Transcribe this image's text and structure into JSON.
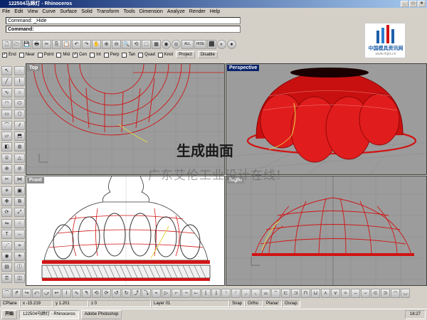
{
  "window": {
    "title": "122504马蹄灯 - Rhinoceros"
  },
  "menu": [
    "File",
    "Edit",
    "View",
    "Curve",
    "Surface",
    "Solid",
    "Transform",
    "Tools",
    "Dimension",
    "Analyze",
    "Render",
    "Help"
  ],
  "command": {
    "history_label": "Command:",
    "history_value": "_Hide",
    "prompt_label": "Command:"
  },
  "toolbar": [
    "🗋",
    "🗁",
    "💾",
    "🖶",
    "✂",
    "⎘",
    "📋",
    "↶",
    "↷",
    "✋",
    "⊕",
    "⊖",
    "🔍",
    "⟲",
    "⬚",
    "▦",
    "◉",
    "◎",
    "ALL",
    "HIDE",
    "⬛",
    "◐",
    "●"
  ],
  "osnap": {
    "items": [
      {
        "label": "End",
        "checked": true
      },
      {
        "label": "Near",
        "checked": false
      },
      {
        "label": "Point",
        "checked": false
      },
      {
        "label": "Mid",
        "checked": false
      },
      {
        "label": "Cen",
        "checked": true
      },
      {
        "label": "Int",
        "checked": false
      },
      {
        "label": "Perp",
        "checked": false
      },
      {
        "label": "Tan",
        "checked": false
      },
      {
        "label": "Quad",
        "checked": false
      },
      {
        "label": "Knot",
        "checked": false
      }
    ],
    "project_label": "Project",
    "disable_label": "Disable"
  },
  "viewports": {
    "top": "Top",
    "perspective": "Perspective",
    "front": "Front",
    "right": "Right"
  },
  "overlay": {
    "line1": "生成曲面",
    "line2": "广东艾伦工业设计在线!"
  },
  "logo": {
    "text": "中国模具资讯网",
    "url": "www.mjzx.cn"
  },
  "status": {
    "cplane": "CPlane",
    "x": "x -15.219",
    "y": "y 1.201",
    "z": "z 0",
    "layer": "Layer 01",
    "snap": "Snap",
    "ortho": "Ortho",
    "planar": "Planar",
    "osnap": "Osnap"
  },
  "taskbar": {
    "start": "开始",
    "rhino_task": "122504马蹄灯 - Rhinoceros",
    "photoshop_task": "Adobe Photoshop",
    "clock": "16:27"
  },
  "colors": {
    "title_active": "#0a246a",
    "model_red": "#d11414",
    "viewport_gray": "#9c9c9c"
  }
}
